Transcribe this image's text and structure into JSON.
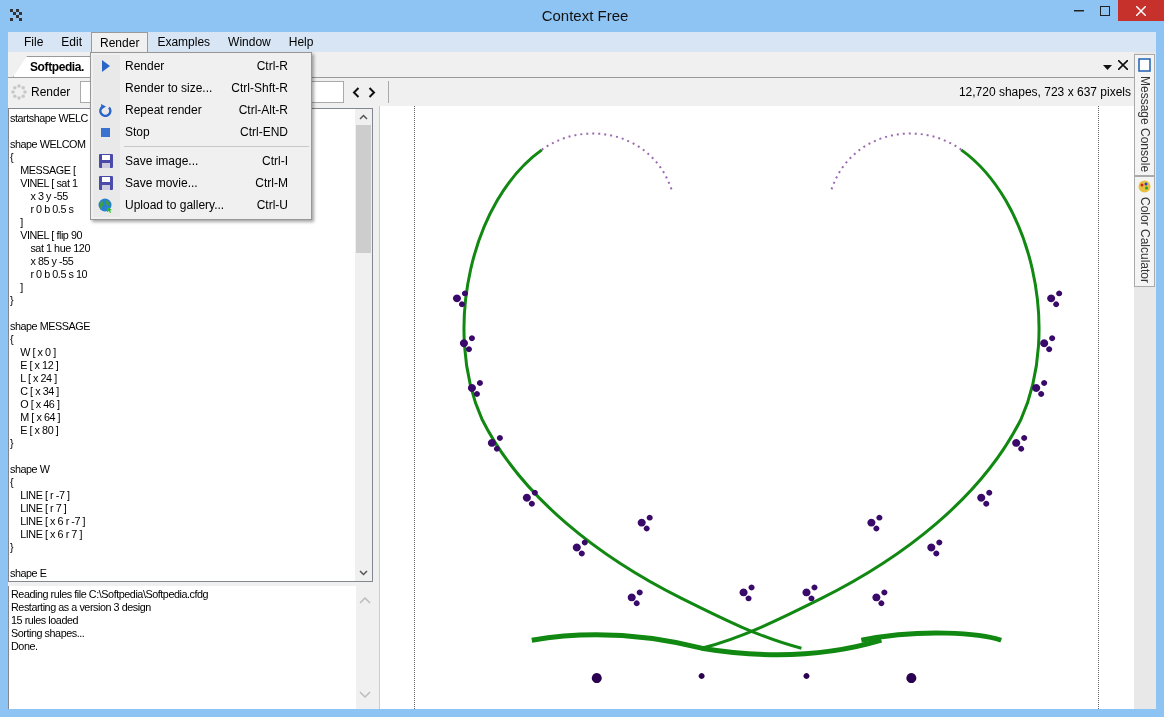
{
  "window": {
    "title": "Context Free"
  },
  "menu_bar": [
    {
      "label": "File",
      "selected": false
    },
    {
      "label": "Edit",
      "selected": false
    },
    {
      "label": "Render",
      "selected": true
    },
    {
      "label": "Examples",
      "selected": false
    },
    {
      "label": "Window",
      "selected": false
    },
    {
      "label": "Help",
      "selected": false
    }
  ],
  "render_menu": [
    {
      "label": "Render",
      "shortcut": "Ctrl-R",
      "kind": "play"
    },
    {
      "label": "Render to size...",
      "shortcut": "Ctrl-Shft-R",
      "kind": "plain"
    },
    {
      "label": "Repeat render",
      "shortcut": "Ctrl-Alt-R",
      "kind": "repeat"
    },
    {
      "label": "Stop",
      "shortcut": "Ctrl-END",
      "kind": "stop"
    },
    {
      "kind": "separator"
    },
    {
      "label": "Save image...",
      "shortcut": "Ctrl-I",
      "kind": "save"
    },
    {
      "label": "Save movie...",
      "shortcut": "Ctrl-M",
      "kind": "save"
    },
    {
      "label": "Upload to gallery...",
      "shortcut": "Ctrl-U",
      "kind": "globe"
    }
  ],
  "document_tab": {
    "label": "Softpedia.",
    "selected": true
  },
  "toolbar": {
    "render_button": "Render",
    "status": "12,720 shapes, 723 x 637 pixels"
  },
  "editor_blocks": [
    [
      "startshape WELC"
    ],
    [
      "shape WELCOM",
      "{",
      "    MESSAGE [",
      "    VINEL [ sat 1",
      "        x 3 y -55",
      "        r 0 b 0.5 s",
      "    ]",
      "    VINEL [ flip 90",
      "        sat 1 hue 120",
      "        x 85 y -55",
      "        r 0 b 0.5 s 10",
      "    ]",
      "}"
    ],
    [
      "shape MESSAGE",
      "{",
      "    W [ x 0 ]",
      "    E [ x 12 ]",
      "    L [ x 24 ]",
      "    C [ x 34 ]",
      "    O [ x 46 ]",
      "    M [ x 64 ]",
      "    E [ x 80 ]",
      "}"
    ],
    [
      "shape W",
      "{",
      "    LINE [ r -7 ]",
      "    LINE [ r 7 ]",
      "    LINE [ x 6 r -7 ]",
      "    LINE [ x 6 r 7 ]",
      "}"
    ],
    [
      "shape E"
    ]
  ],
  "console_lines": [
    "Reading rules file C:\\Softpedia\\Softpedia.cfdg",
    "Restarting as a version 3 design",
    "15 rules loaded",
    "Sorting shapes...",
    "Done."
  ],
  "side_tabs": [
    {
      "label": "Message Console",
      "kind": "window"
    },
    {
      "label": "Color Calculator",
      "kind": "palette"
    }
  ],
  "render_view": {
    "kind": "picture"
  }
}
